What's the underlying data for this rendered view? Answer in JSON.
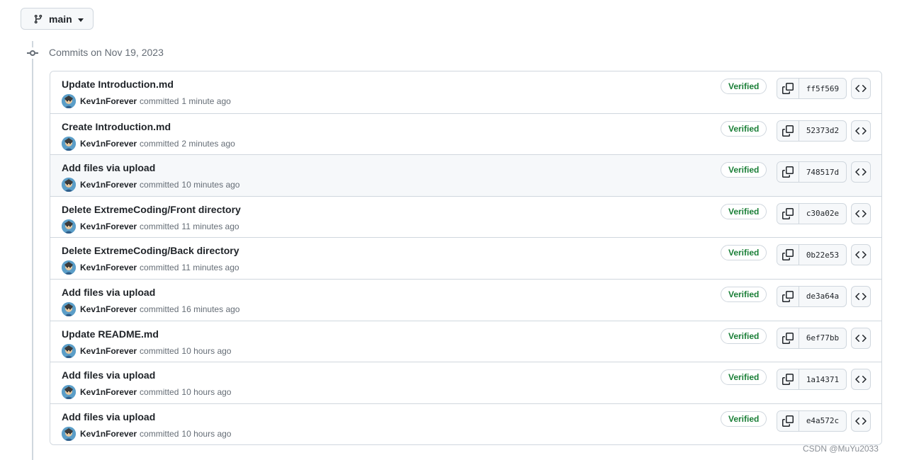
{
  "branch": {
    "name": "main"
  },
  "group": {
    "title": "Commits on Nov 19, 2023"
  },
  "commits": [
    {
      "message": "Update Introduction.md",
      "author": "Kev1nForever",
      "verb": "committed",
      "time": "1 minute ago",
      "badge": "Verified",
      "sha": "ff5f569"
    },
    {
      "message": "Create Introduction.md",
      "author": "Kev1nForever",
      "verb": "committed",
      "time": "2 minutes ago",
      "badge": "Verified",
      "sha": "52373d2"
    },
    {
      "message": "Add files via upload",
      "author": "Kev1nForever",
      "verb": "committed",
      "time": "10 minutes ago",
      "badge": "Verified",
      "sha": "748517d"
    },
    {
      "message": "Delete ExtremeCoding/Front directory",
      "author": "Kev1nForever",
      "verb": "committed",
      "time": "11 minutes ago",
      "badge": "Verified",
      "sha": "c30a02e"
    },
    {
      "message": "Delete ExtremeCoding/Back directory",
      "author": "Kev1nForever",
      "verb": "committed",
      "time": "11 minutes ago",
      "badge": "Verified",
      "sha": "0b22e53"
    },
    {
      "message": "Add files via upload",
      "author": "Kev1nForever",
      "verb": "committed",
      "time": "16 minutes ago",
      "badge": "Verified",
      "sha": "de3a64a"
    },
    {
      "message": "Update README.md",
      "author": "Kev1nForever",
      "verb": "committed",
      "time": "10 hours ago",
      "badge": "Verified",
      "sha": "6ef77bb"
    },
    {
      "message": "Add files via upload",
      "author": "Kev1nForever",
      "verb": "committed",
      "time": "10 hours ago",
      "badge": "Verified",
      "sha": "1a14371"
    },
    {
      "message": "Add files via upload",
      "author": "Kev1nForever",
      "verb": "committed",
      "time": "10 hours ago",
      "badge": "Verified",
      "sha": "e4a572c"
    }
  ],
  "icons": {
    "branch": "git-branch-icon",
    "caret": "triangle-down-icon",
    "timeline": "git-commit-icon",
    "copy": "copy-icon",
    "browse": "code-icon"
  },
  "colors": {
    "verified": "#1a7f37",
    "border": "#d0d7de",
    "muted": "#656d76",
    "hover_row": "#f6f8fa"
  },
  "watermark": "CSDN @MuYu2033"
}
